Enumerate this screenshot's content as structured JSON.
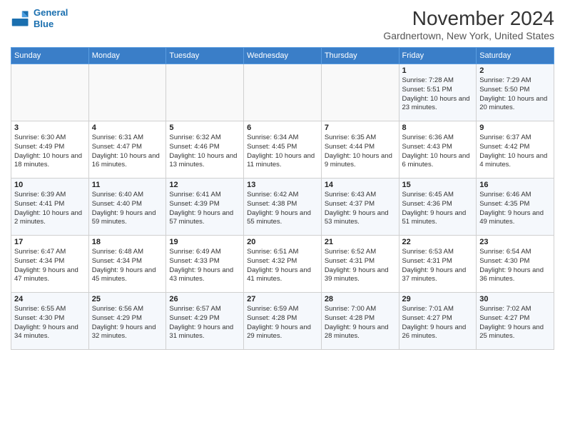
{
  "header": {
    "logo_line1": "General",
    "logo_line2": "Blue",
    "title": "November 2024",
    "subtitle": "Gardnertown, New York, United States"
  },
  "calendar": {
    "days_of_week": [
      "Sunday",
      "Monday",
      "Tuesday",
      "Wednesday",
      "Thursday",
      "Friday",
      "Saturday"
    ],
    "weeks": [
      [
        {
          "day": "",
          "info": ""
        },
        {
          "day": "",
          "info": ""
        },
        {
          "day": "",
          "info": ""
        },
        {
          "day": "",
          "info": ""
        },
        {
          "day": "",
          "info": ""
        },
        {
          "day": "1",
          "info": "Sunrise: 7:28 AM\nSunset: 5:51 PM\nDaylight: 10 hours and 23 minutes."
        },
        {
          "day": "2",
          "info": "Sunrise: 7:29 AM\nSunset: 5:50 PM\nDaylight: 10 hours and 20 minutes."
        }
      ],
      [
        {
          "day": "3",
          "info": "Sunrise: 6:30 AM\nSunset: 4:49 PM\nDaylight: 10 hours and 18 minutes."
        },
        {
          "day": "4",
          "info": "Sunrise: 6:31 AM\nSunset: 4:47 PM\nDaylight: 10 hours and 16 minutes."
        },
        {
          "day": "5",
          "info": "Sunrise: 6:32 AM\nSunset: 4:46 PM\nDaylight: 10 hours and 13 minutes."
        },
        {
          "day": "6",
          "info": "Sunrise: 6:34 AM\nSunset: 4:45 PM\nDaylight: 10 hours and 11 minutes."
        },
        {
          "day": "7",
          "info": "Sunrise: 6:35 AM\nSunset: 4:44 PM\nDaylight: 10 hours and 9 minutes."
        },
        {
          "day": "8",
          "info": "Sunrise: 6:36 AM\nSunset: 4:43 PM\nDaylight: 10 hours and 6 minutes."
        },
        {
          "day": "9",
          "info": "Sunrise: 6:37 AM\nSunset: 4:42 PM\nDaylight: 10 hours and 4 minutes."
        }
      ],
      [
        {
          "day": "10",
          "info": "Sunrise: 6:39 AM\nSunset: 4:41 PM\nDaylight: 10 hours and 2 minutes."
        },
        {
          "day": "11",
          "info": "Sunrise: 6:40 AM\nSunset: 4:40 PM\nDaylight: 9 hours and 59 minutes."
        },
        {
          "day": "12",
          "info": "Sunrise: 6:41 AM\nSunset: 4:39 PM\nDaylight: 9 hours and 57 minutes."
        },
        {
          "day": "13",
          "info": "Sunrise: 6:42 AM\nSunset: 4:38 PM\nDaylight: 9 hours and 55 minutes."
        },
        {
          "day": "14",
          "info": "Sunrise: 6:43 AM\nSunset: 4:37 PM\nDaylight: 9 hours and 53 minutes."
        },
        {
          "day": "15",
          "info": "Sunrise: 6:45 AM\nSunset: 4:36 PM\nDaylight: 9 hours and 51 minutes."
        },
        {
          "day": "16",
          "info": "Sunrise: 6:46 AM\nSunset: 4:35 PM\nDaylight: 9 hours and 49 minutes."
        }
      ],
      [
        {
          "day": "17",
          "info": "Sunrise: 6:47 AM\nSunset: 4:34 PM\nDaylight: 9 hours and 47 minutes."
        },
        {
          "day": "18",
          "info": "Sunrise: 6:48 AM\nSunset: 4:34 PM\nDaylight: 9 hours and 45 minutes."
        },
        {
          "day": "19",
          "info": "Sunrise: 6:49 AM\nSunset: 4:33 PM\nDaylight: 9 hours and 43 minutes."
        },
        {
          "day": "20",
          "info": "Sunrise: 6:51 AM\nSunset: 4:32 PM\nDaylight: 9 hours and 41 minutes."
        },
        {
          "day": "21",
          "info": "Sunrise: 6:52 AM\nSunset: 4:31 PM\nDaylight: 9 hours and 39 minutes."
        },
        {
          "day": "22",
          "info": "Sunrise: 6:53 AM\nSunset: 4:31 PM\nDaylight: 9 hours and 37 minutes."
        },
        {
          "day": "23",
          "info": "Sunrise: 6:54 AM\nSunset: 4:30 PM\nDaylight: 9 hours and 36 minutes."
        }
      ],
      [
        {
          "day": "24",
          "info": "Sunrise: 6:55 AM\nSunset: 4:30 PM\nDaylight: 9 hours and 34 minutes."
        },
        {
          "day": "25",
          "info": "Sunrise: 6:56 AM\nSunset: 4:29 PM\nDaylight: 9 hours and 32 minutes."
        },
        {
          "day": "26",
          "info": "Sunrise: 6:57 AM\nSunset: 4:29 PM\nDaylight: 9 hours and 31 minutes."
        },
        {
          "day": "27",
          "info": "Sunrise: 6:59 AM\nSunset: 4:28 PM\nDaylight: 9 hours and 29 minutes."
        },
        {
          "day": "28",
          "info": "Sunrise: 7:00 AM\nSunset: 4:28 PM\nDaylight: 9 hours and 28 minutes."
        },
        {
          "day": "29",
          "info": "Sunrise: 7:01 AM\nSunset: 4:27 PM\nDaylight: 9 hours and 26 minutes."
        },
        {
          "day": "30",
          "info": "Sunrise: 7:02 AM\nSunset: 4:27 PM\nDaylight: 9 hours and 25 minutes."
        }
      ]
    ]
  }
}
